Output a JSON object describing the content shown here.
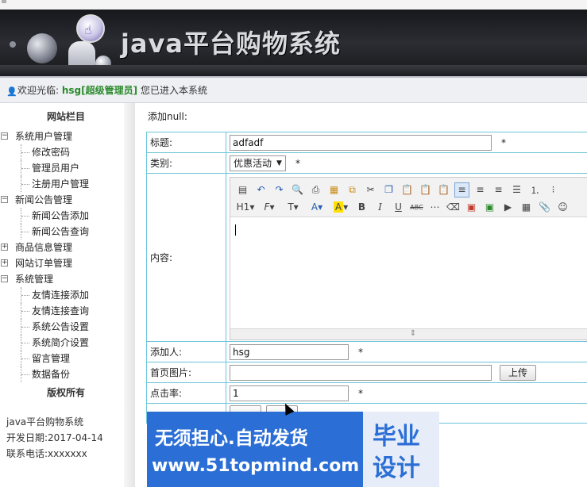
{
  "header": {
    "title": "java平台购物系统"
  },
  "welcome": {
    "prefix": "欢迎光临:",
    "user": "hsg[超级管理员]",
    "suffix": "您已进入本系统"
  },
  "sidebar": {
    "title": "网站栏目",
    "groups": [
      {
        "label": "系统用户管理",
        "expanded": true,
        "items": [
          "修改密码",
          "管理员用户",
          "注册用户管理"
        ]
      },
      {
        "label": "新闻公告管理",
        "expanded": true,
        "items": [
          "新闻公告添加",
          "新闻公告查询"
        ]
      },
      {
        "label": "商品信息管理",
        "expanded": false,
        "items": []
      },
      {
        "label": "网站订单管理",
        "expanded": false,
        "items": []
      },
      {
        "label": "系统管理",
        "expanded": true,
        "items": [
          "友情连接添加",
          "友情连接查询",
          "系统公告设置",
          "系统简介设置",
          "留言管理",
          "数据备份"
        ]
      }
    ],
    "copyright": "版权所有",
    "info": {
      "system": "java平台购物系统",
      "date": "开发日期:2017-04-14",
      "phone": "联系电话:xxxxxxx"
    }
  },
  "main": {
    "caption": "添加null:",
    "required_mark": "*",
    "fields": {
      "title": {
        "label": "标题:",
        "value": "adfadf"
      },
      "category": {
        "label": "类别:",
        "value": "优惠活动"
      },
      "content": {
        "label": "内容:"
      },
      "author": {
        "label": "添加人:",
        "value": "hsg"
      },
      "image": {
        "label": "首页图片:",
        "value": "",
        "button": "上传"
      },
      "clicks": {
        "label": "点击率:",
        "value": "1"
      }
    },
    "editor": {
      "row1_icons": [
        "source-icon",
        "undo-icon",
        "redo-icon",
        "preview-icon",
        "print-icon",
        "template-icon",
        "code-icon",
        "cut-icon",
        "copy-icon",
        "paste-icon",
        "paste-text-icon",
        "paste-word-icon",
        "align-left-icon",
        "align-center-icon",
        "align-right-icon",
        "justify-icon",
        "ordered-list-icon",
        "unordered-list-icon"
      ],
      "row2": {
        "heading": "H1",
        "font": "F",
        "size": "T",
        "forecolor": "A",
        "hilite": "A",
        "bold": "B",
        "italic": "I",
        "underline": "U",
        "strike": "ABC"
      }
    }
  },
  "watermark": {
    "line1": "无须担心.自动发货",
    "line2": "www.51topmind.com",
    "badge1": "毕业",
    "badge2": "设计"
  }
}
